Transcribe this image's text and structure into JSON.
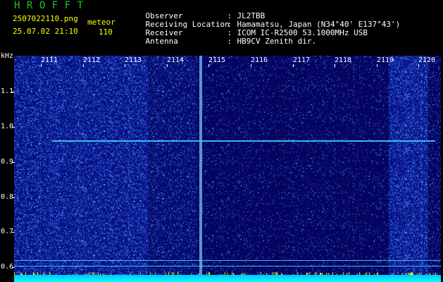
{
  "header": {
    "app_title": "HROFFT",
    "file_name": "2507022110.png",
    "timestamp": "25.07.02 21:10",
    "type_label": "meteor",
    "count": "110"
  },
  "station": [
    {
      "key": "Observer",
      "sep": ":",
      "value": "JL2TBB"
    },
    {
      "key": "Receiving Location",
      "sep": ":",
      "value": "Hamamatsu, Japan (N34°40' E137°43')"
    },
    {
      "key": "Receiver",
      "sep": ":",
      "value": "ICOM IC-R2500 53.1000MHz USB"
    },
    {
      "key": "Antenna",
      "sep": ":",
      "value": "HB9CV Zenith dir."
    }
  ],
  "spectrogram": {
    "freq_unit": "kHz",
    "freq_labels": [
      "1.1",
      "1.0",
      "0.9",
      "0.8",
      "0.7",
      "0.6"
    ],
    "freq_values": [
      1.1,
      1.0,
      0.9,
      0.8,
      0.7,
      0.6
    ],
    "freq_range": [
      0.575,
      1.2
    ],
    "time_labels": [
      "2111",
      "2112",
      "2113",
      "2114",
      "2115",
      "2116",
      "2117",
      "2118",
      "2119",
      "2120"
    ],
    "time_range": [
      2110.4,
      2120.3
    ],
    "colors": {
      "background": "#050560",
      "noise_dot": "#3c7dff",
      "echo": "#3fd6ff",
      "floor": "#00e6ff",
      "spike": "#ffff00"
    }
  }
}
